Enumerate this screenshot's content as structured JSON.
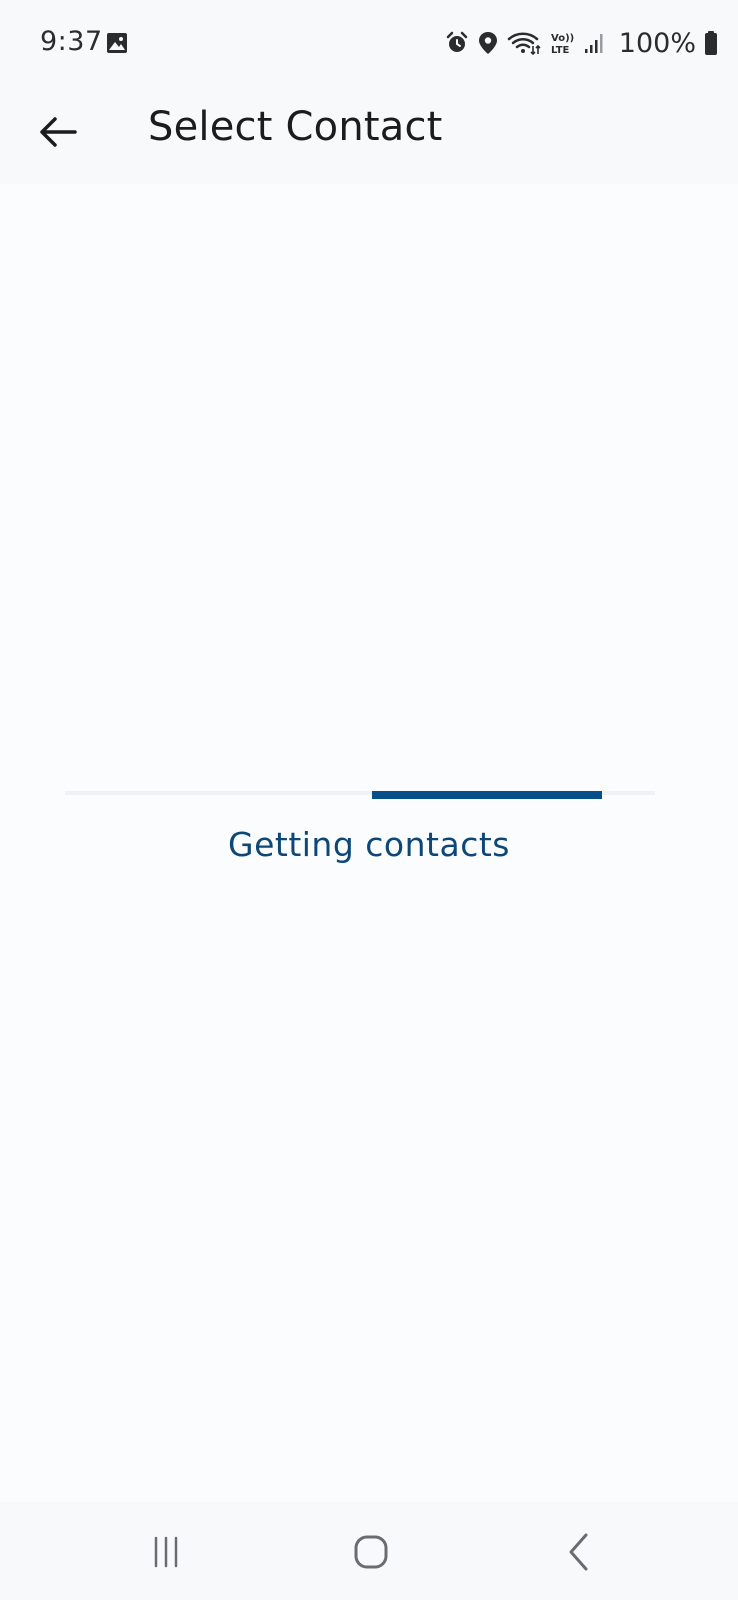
{
  "status_bar": {
    "time": "9:37",
    "battery_text": "100%",
    "icons": [
      "gallery-icon",
      "alarm-icon",
      "location-icon",
      "wifi-icon",
      "volte-icon",
      "signal-icon",
      "battery-icon"
    ]
  },
  "app_bar": {
    "title": "Select Contact",
    "back_icon": "arrow-left-icon"
  },
  "loading": {
    "label": "Getting contacts",
    "indicator_start_fraction": 0.52,
    "indicator_end_fraction": 0.91
  },
  "nav_bar": {
    "icons": [
      "recent-apps-icon",
      "home-icon",
      "back-icon"
    ]
  },
  "colors": {
    "accent": "#064f89",
    "accent_text": "#0d4778",
    "background": "#fbfcfd",
    "bar_background": "#f7f9fb",
    "text_primary": "#1b1c1e"
  }
}
